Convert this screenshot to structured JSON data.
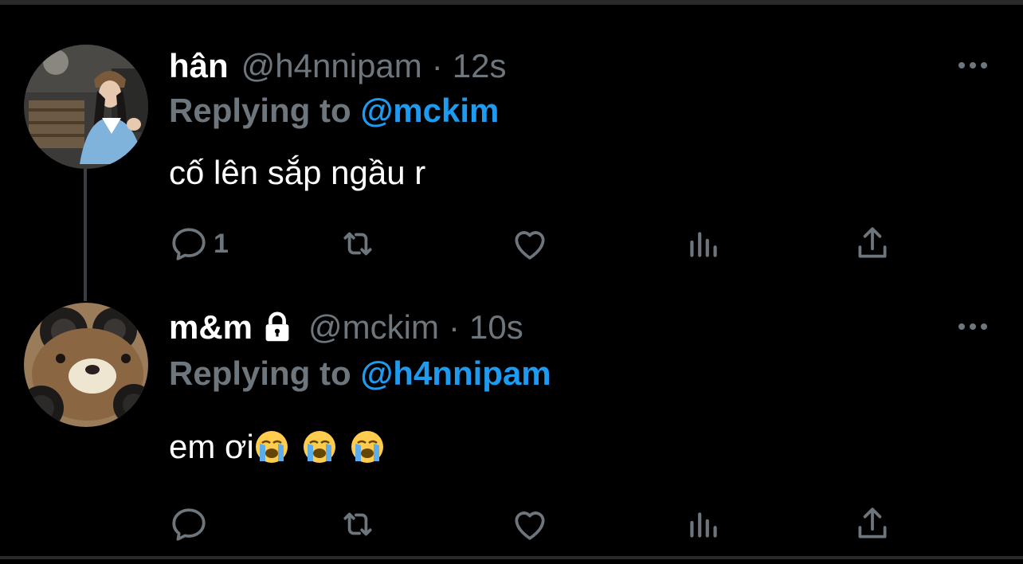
{
  "tweets": [
    {
      "name": "hân",
      "handle": "@h4nnipam",
      "separator": "·",
      "time": "12s",
      "replying_prefix": "Replying to",
      "replying_to": "@mckim",
      "text": "cố lên sắp ngầu r",
      "reply_count": "1",
      "avatar_icon": "avatar-photo-girl",
      "locked": false
    },
    {
      "name": "m&m",
      "handle": "@mckim",
      "separator": "·",
      "time": "10s",
      "replying_prefix": "Replying to",
      "replying_to": "@h4nnipam",
      "text": "em ơi",
      "emojis": [
        "loudly-crying-face",
        "loudly-crying-face",
        "loudly-crying-face"
      ],
      "reply_count": "",
      "avatar_icon": "avatar-photo-bear",
      "locked": true
    }
  ],
  "colors": {
    "background": "#000000",
    "secondary_text": "#6e767d",
    "accent": "#1d9bf0",
    "thread_line": "#3a3d41"
  },
  "icons": [
    "reply-icon",
    "retweet-icon",
    "like-icon",
    "analytics-icon",
    "share-icon",
    "more-icon",
    "lock-icon"
  ]
}
